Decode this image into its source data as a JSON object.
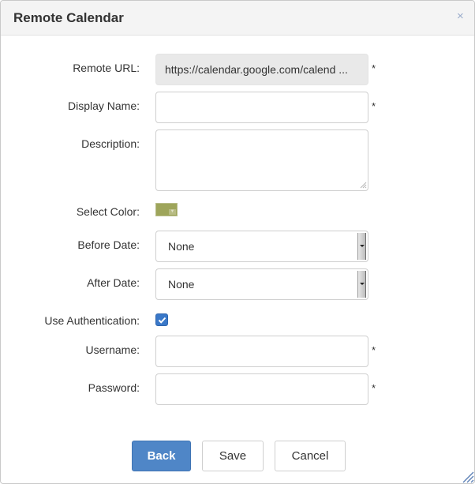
{
  "dialog": {
    "title": "Remote Calendar",
    "close_glyph": "×"
  },
  "form": {
    "remote_url": {
      "label": "Remote URL:",
      "value": "https://calendar.google.com/calend ...",
      "required": "*"
    },
    "display_name": {
      "label": "Display Name:",
      "value": "",
      "required": "*"
    },
    "description": {
      "label": "Description:",
      "value": ""
    },
    "color": {
      "label": "Select Color:",
      "value": "#9ea55b"
    },
    "before_date": {
      "label": "Before Date:",
      "value": "None"
    },
    "after_date": {
      "label": "After Date:",
      "value": "None"
    },
    "use_authentication": {
      "label": "Use Authentication:",
      "checked": true
    },
    "username": {
      "label": "Username:",
      "value": "",
      "required": "*"
    },
    "password": {
      "label": "Password:",
      "value": "",
      "required": "*"
    }
  },
  "buttons": {
    "back": "Back",
    "save": "Save",
    "cancel": "Cancel"
  },
  "colors": {
    "primary": "#4f86c7",
    "checkbox": "#3a78c8",
    "title_bar": "#f4f4f4"
  }
}
